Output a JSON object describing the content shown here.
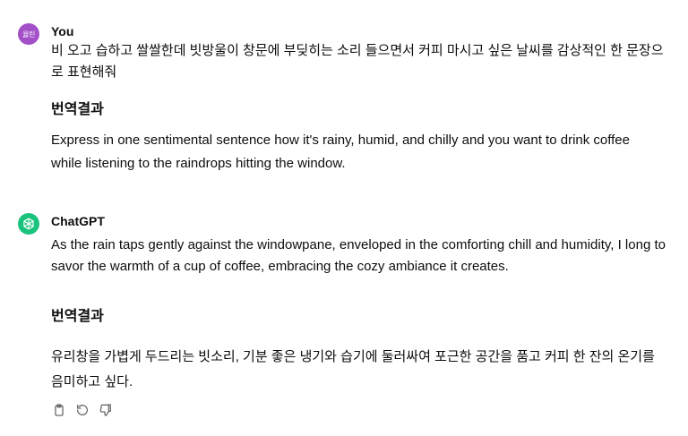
{
  "user_message": {
    "author": "You",
    "avatar_text": "율린",
    "avatar_color": "#a34fc7",
    "text": "비 오고 습하고 쌀쌀한데 빗방울이 창문에 부딪히는 소리 들으면서 커피 마시고 싶은  날씨를 감상적인 한 문장으로 표현해줘",
    "translation_title": "번역결과",
    "translation_text": "Express in one sentimental sentence how it's rainy, humid, and chilly and you want to drink coffee while listening to the raindrops hitting the window."
  },
  "bot_message": {
    "author": "ChatGPT",
    "avatar_icon": "openai-logo-icon",
    "avatar_color": "#19c37d",
    "text": "As the rain taps gently against the windowpane, enveloped in the comforting chill and humidity, I long to savor the warmth of a cup of coffee, embracing the cozy ambiance it creates.",
    "translation_title": "번역결과",
    "translation_text": "유리창을 가볍게 두드리는 빗소리, 기분 좋은 냉기와 습기에 둘러싸여 포근한 공간을 품고 커피 한 잔의 온기를 음미하고 싶다.",
    "actions": [
      "copy-icon",
      "regenerate-icon",
      "thumbs-down-icon"
    ]
  }
}
